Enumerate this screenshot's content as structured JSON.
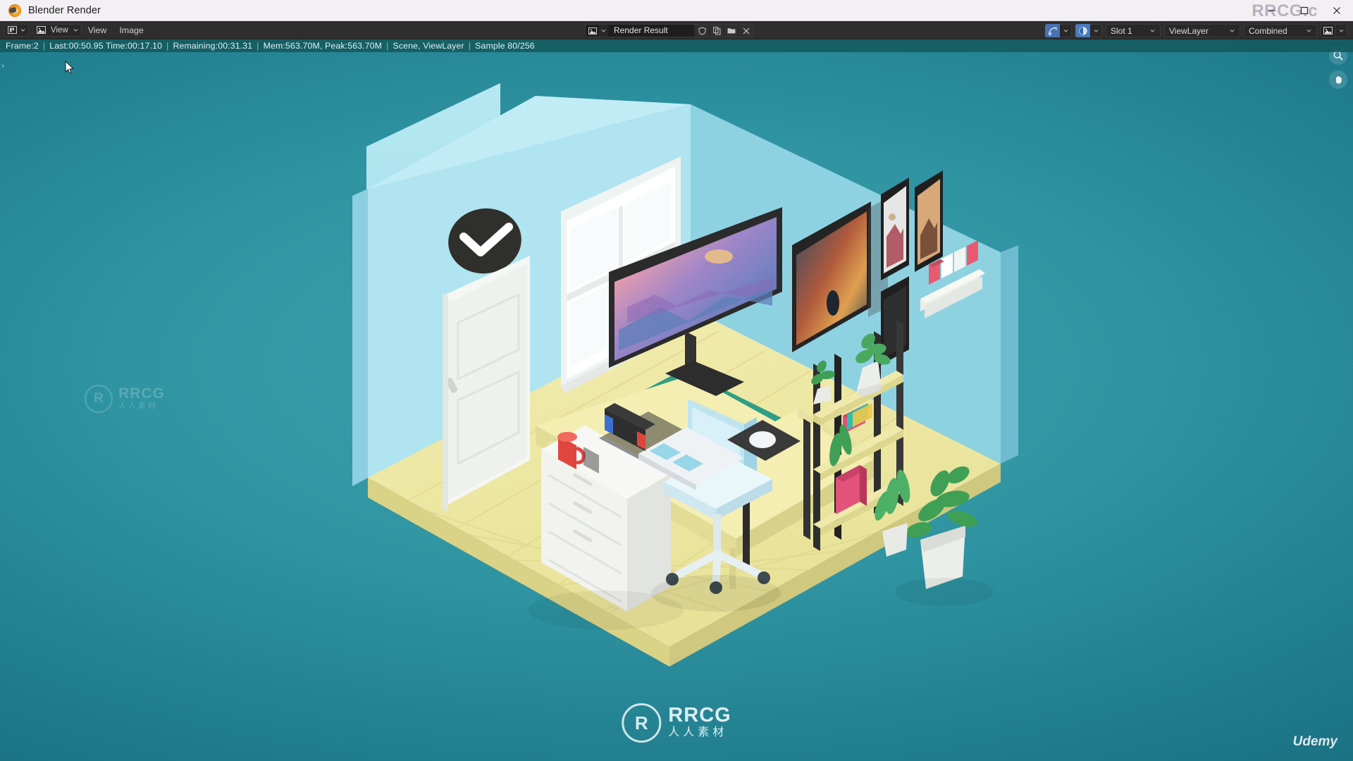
{
  "window": {
    "title": "Blender Render",
    "app_icon": "blender-logo-icon",
    "watermark": "RRCG.c",
    "minimize": "–",
    "maximize": "□",
    "close": "✕"
  },
  "header": {
    "editor_type_icon": "editor-type-icon",
    "view_mode_icon": "image-editor-icon",
    "view_mode_label": "View",
    "menus": [
      {
        "label": "View"
      },
      {
        "label": "Image"
      }
    ],
    "image_field": {
      "icon": "image-datablock-icon",
      "name": "Render Result",
      "tools": [
        {
          "icon": "shield-icon",
          "glyph": "⛉"
        },
        {
          "icon": "copy-icon",
          "glyph": "❐"
        },
        {
          "icon": "folder-icon",
          "glyph": "▰"
        },
        {
          "icon": "close-icon",
          "glyph": "✕"
        }
      ]
    },
    "right": {
      "render_engine_icon": "render-pass-icon",
      "display_channel_icon": "display-channel-icon",
      "slot_label": "Slot 1",
      "viewlayer_label": "ViewLayer",
      "pass_label": "Combined",
      "image_icon": "image-icon"
    }
  },
  "status": {
    "parts": [
      "Frame:2",
      "Last:00:50.95 Time:00:17.10",
      "Remaining:00:31.31",
      "Mem:563.70M, Peak:563.70M",
      "Scene, ViewLayer",
      "Sample 80/256"
    ],
    "separator": "|",
    "background_color": "#14585c"
  },
  "viewport": {
    "tools": [
      {
        "name": "zoom-tool-icon",
        "glyph": "⚲"
      },
      {
        "name": "pan-tool-icon",
        "glyph": "✋"
      }
    ],
    "left_edge_handle": "›",
    "cursor": "mouse-pointer"
  },
  "render_scene": {
    "description": "Isometric low-poly bedroom office diorama",
    "background_color": "#2f93a1",
    "colors": {
      "wall": "#a8e0ec",
      "wall_side": "#8ed1e0",
      "floor": "#f0eaa6",
      "floor_shadow": "#e3dc93",
      "rug": "#2f9e86",
      "desk": "#f2ecab",
      "door": "#f2f4f2",
      "chair": "#bfe5f0",
      "monitor_frame": "#2a2a2a",
      "plant_green": "#3f9f55"
    },
    "objects": [
      "wall-clock",
      "door",
      "window",
      "desk",
      "monitor",
      "keyboard",
      "mouse",
      "mousepad",
      "game-console",
      "mug",
      "drawer-unit",
      "office-chair",
      "rug",
      "shelf-unit",
      "wall-art-large",
      "wall-art-small-top",
      "wall-art-small-bottom",
      "wall-shelf-books",
      "potted-plant-shelf",
      "potted-plant-floor-large",
      "potted-plant-floor-small"
    ]
  },
  "watermarks": {
    "center": {
      "big": "RRCG",
      "small": "人人素材",
      "ring": "R"
    },
    "faint": {
      "big": "RRCG",
      "small": "人人素材",
      "ring": "R"
    },
    "brand": "Udemy"
  }
}
